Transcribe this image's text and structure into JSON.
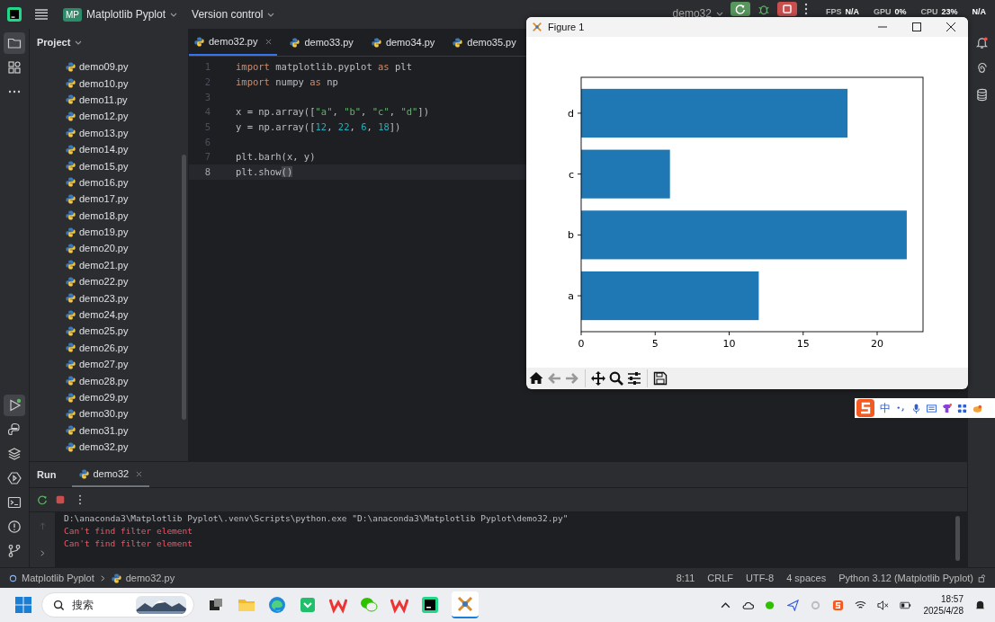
{
  "top_bar": {
    "project_badge": "MP",
    "project": "Matplotlib Pyplot",
    "vcs": "Version control",
    "run_config": "demo32",
    "monitor": [
      {
        "label": "FPS",
        "value": "N/A"
      },
      {
        "label": "GPU",
        "value": "0%"
      },
      {
        "label": "CPU",
        "value": "23%"
      },
      {
        "value": "N/A"
      }
    ]
  },
  "tool_strip": [
    {
      "kind": "folder",
      "selected": true
    },
    {
      "kind": "structure",
      "selected": false
    },
    {
      "kind": "more",
      "selected": false
    }
  ],
  "tool_strip_bottom": [
    {
      "kind": "run",
      "selected": true
    },
    {
      "kind": "console",
      "selected": false
    },
    {
      "kind": "layers",
      "selected": false
    },
    {
      "kind": "services",
      "selected": false
    },
    {
      "kind": "terminal",
      "selected": false
    },
    {
      "kind": "problems",
      "selected": false
    },
    {
      "kind": "git",
      "selected": false
    }
  ],
  "project": {
    "title": "Project",
    "files": [
      "demo09.py",
      "demo10.py",
      "demo11.py",
      "demo12.py",
      "demo13.py",
      "demo14.py",
      "demo15.py",
      "demo16.py",
      "demo17.py",
      "demo18.py",
      "demo19.py",
      "demo20.py",
      "demo21.py",
      "demo22.py",
      "demo23.py",
      "demo24.py",
      "demo25.py",
      "demo26.py",
      "demo27.py",
      "demo28.py",
      "demo29.py",
      "demo30.py",
      "demo31.py",
      "demo32.py"
    ]
  },
  "tabs": [
    {
      "label": "demo32.py",
      "selected": true
    },
    {
      "label": "demo33.py",
      "selected": false
    },
    {
      "label": "demo34.py",
      "selected": false
    },
    {
      "label": "demo35.py",
      "selected": false
    }
  ],
  "code": [
    {
      "number": "1",
      "current": false,
      "tokens": [
        {
          "kind": "keyword",
          "text": "import"
        },
        {
          "kind": "plain",
          "text": " matplotlib.pyplot "
        },
        {
          "kind": "keyword",
          "text": "as"
        },
        {
          "kind": "plain",
          "text": " plt"
        }
      ]
    },
    {
      "number": "2",
      "current": false,
      "tokens": [
        {
          "kind": "keyword",
          "text": "import"
        },
        {
          "kind": "plain",
          "text": " numpy "
        },
        {
          "kind": "keyword",
          "text": "as"
        },
        {
          "kind": "plain",
          "text": " np"
        }
      ]
    },
    {
      "number": "3",
      "current": false
    },
    {
      "number": "4",
      "current": false,
      "tokens": [
        {
          "kind": "plain",
          "text": "x = np.array(["
        },
        {
          "kind": "string",
          "text": "\"a\""
        },
        {
          "kind": "plain",
          "text": ", "
        },
        {
          "kind": "string",
          "text": "\"b\""
        },
        {
          "kind": "plain",
          "text": ", "
        },
        {
          "kind": "string",
          "text": "\"c\""
        },
        {
          "kind": "plain",
          "text": ", "
        },
        {
          "kind": "string",
          "text": "\"d\""
        },
        {
          "kind": "plain",
          "text": "])"
        }
      ]
    },
    {
      "number": "5",
      "current": false,
      "tokens": [
        {
          "kind": "plain",
          "text": "y = np.array(["
        },
        {
          "kind": "number",
          "text": "12"
        },
        {
          "kind": "plain",
          "text": ", "
        },
        {
          "kind": "number",
          "text": "22"
        },
        {
          "kind": "plain",
          "text": ", "
        },
        {
          "kind": "number",
          "text": "6"
        },
        {
          "kind": "plain",
          "text": ", "
        },
        {
          "kind": "number",
          "text": "18"
        },
        {
          "kind": "plain",
          "text": "])"
        }
      ]
    },
    {
      "number": "6",
      "current": false
    },
    {
      "number": "7",
      "current": false,
      "tokens": [
        {
          "kind": "plain",
          "text": "plt.barh(x, y)"
        }
      ]
    },
    {
      "number": "8",
      "current": true,
      "tokens": [
        {
          "kind": "plain",
          "text": "plt.show"
        },
        {
          "kind": "match",
          "text": "()"
        }
      ]
    }
  ],
  "figure": {
    "title": "Figure 1",
    "chart_data": {
      "type": "bar",
      "orientation": "horizontal",
      "categories": [
        "d",
        "c",
        "b",
        "a"
      ],
      "values": [
        18,
        6,
        22,
        12
      ],
      "xlim": [
        0,
        23.1
      ],
      "xticks": [
        0,
        5,
        10,
        15,
        20
      ]
    }
  },
  "run": {
    "title": "Run",
    "tab": {
      "label": "demo32",
      "selected": true
    },
    "output": [
      {
        "kind": "command",
        "text": "D:\\anaconda3\\Matplotlib Pyplot\\.venv\\Scripts\\python.exe \"D:\\anaconda3\\Matplotlib Pyplot\\demo32.py\""
      },
      {
        "kind": "error",
        "text": "Can't find filter element"
      },
      {
        "kind": "error",
        "text": "Can't find filter element"
      }
    ]
  },
  "ime": {
    "mode": "中"
  },
  "status_bar": {
    "breadcrumb": [
      "Matplotlib Pyplot",
      "demo32.py"
    ],
    "items": [
      "8:11",
      "CRLF",
      "UTF-8",
      "4 spaces",
      "Python 3.12 (Matplotlib Pyplot)"
    ]
  },
  "taskbar": {
    "search_placeholder": "搜索",
    "time": "18:57",
    "date": "2025/4/28"
  }
}
